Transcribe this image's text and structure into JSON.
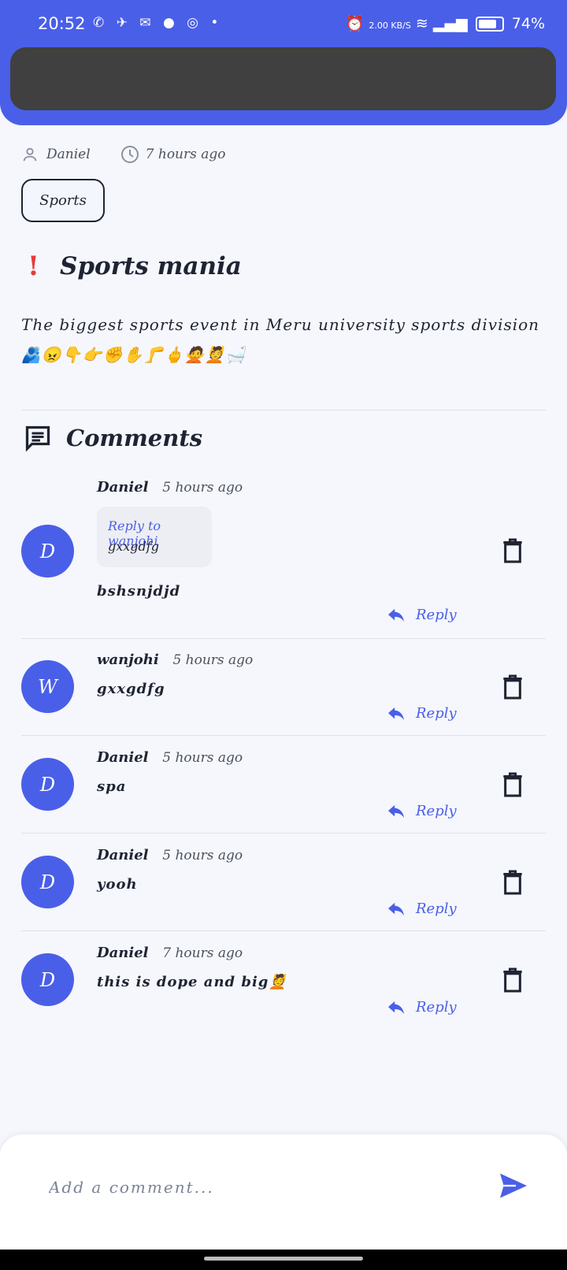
{
  "status_bar": {
    "time": "20:52",
    "net_speed": "2.00 KB/S",
    "battery": "74%"
  },
  "post": {
    "author": "Daniel",
    "time": "7 hours ago",
    "category": "Sports",
    "title": "Sports mania",
    "body": "The biggest sports event in Meru university sports division 🫂😠👇👉✊✋🦵🖕🙅💆🛁"
  },
  "comments_section": {
    "title": "Comments",
    "reply_label": "Reply",
    "items": [
      {
        "initial": "D",
        "author": "Daniel",
        "time": "5 hours ago",
        "quote_label": "Reply to wanjohi",
        "quote_text": "gxxgdfg",
        "text": "bshsnjdjd"
      },
      {
        "initial": "W",
        "author": "wanjohi",
        "time": "5 hours ago",
        "text": "gxxgdfg"
      },
      {
        "initial": "D",
        "author": "Daniel",
        "time": "5 hours ago",
        "text": "spa"
      },
      {
        "initial": "D",
        "author": "Daniel",
        "time": "5 hours ago",
        "text": "yooh"
      },
      {
        "initial": "D",
        "author": "Daniel",
        "time": "7 hours ago",
        "text": "this is dope and big💆"
      }
    ]
  },
  "composer": {
    "placeholder": "Add a comment...",
    "value": ""
  },
  "colors": {
    "accent": "#4a5fe8",
    "danger": "#e53b3b",
    "text": "#1f2433"
  }
}
